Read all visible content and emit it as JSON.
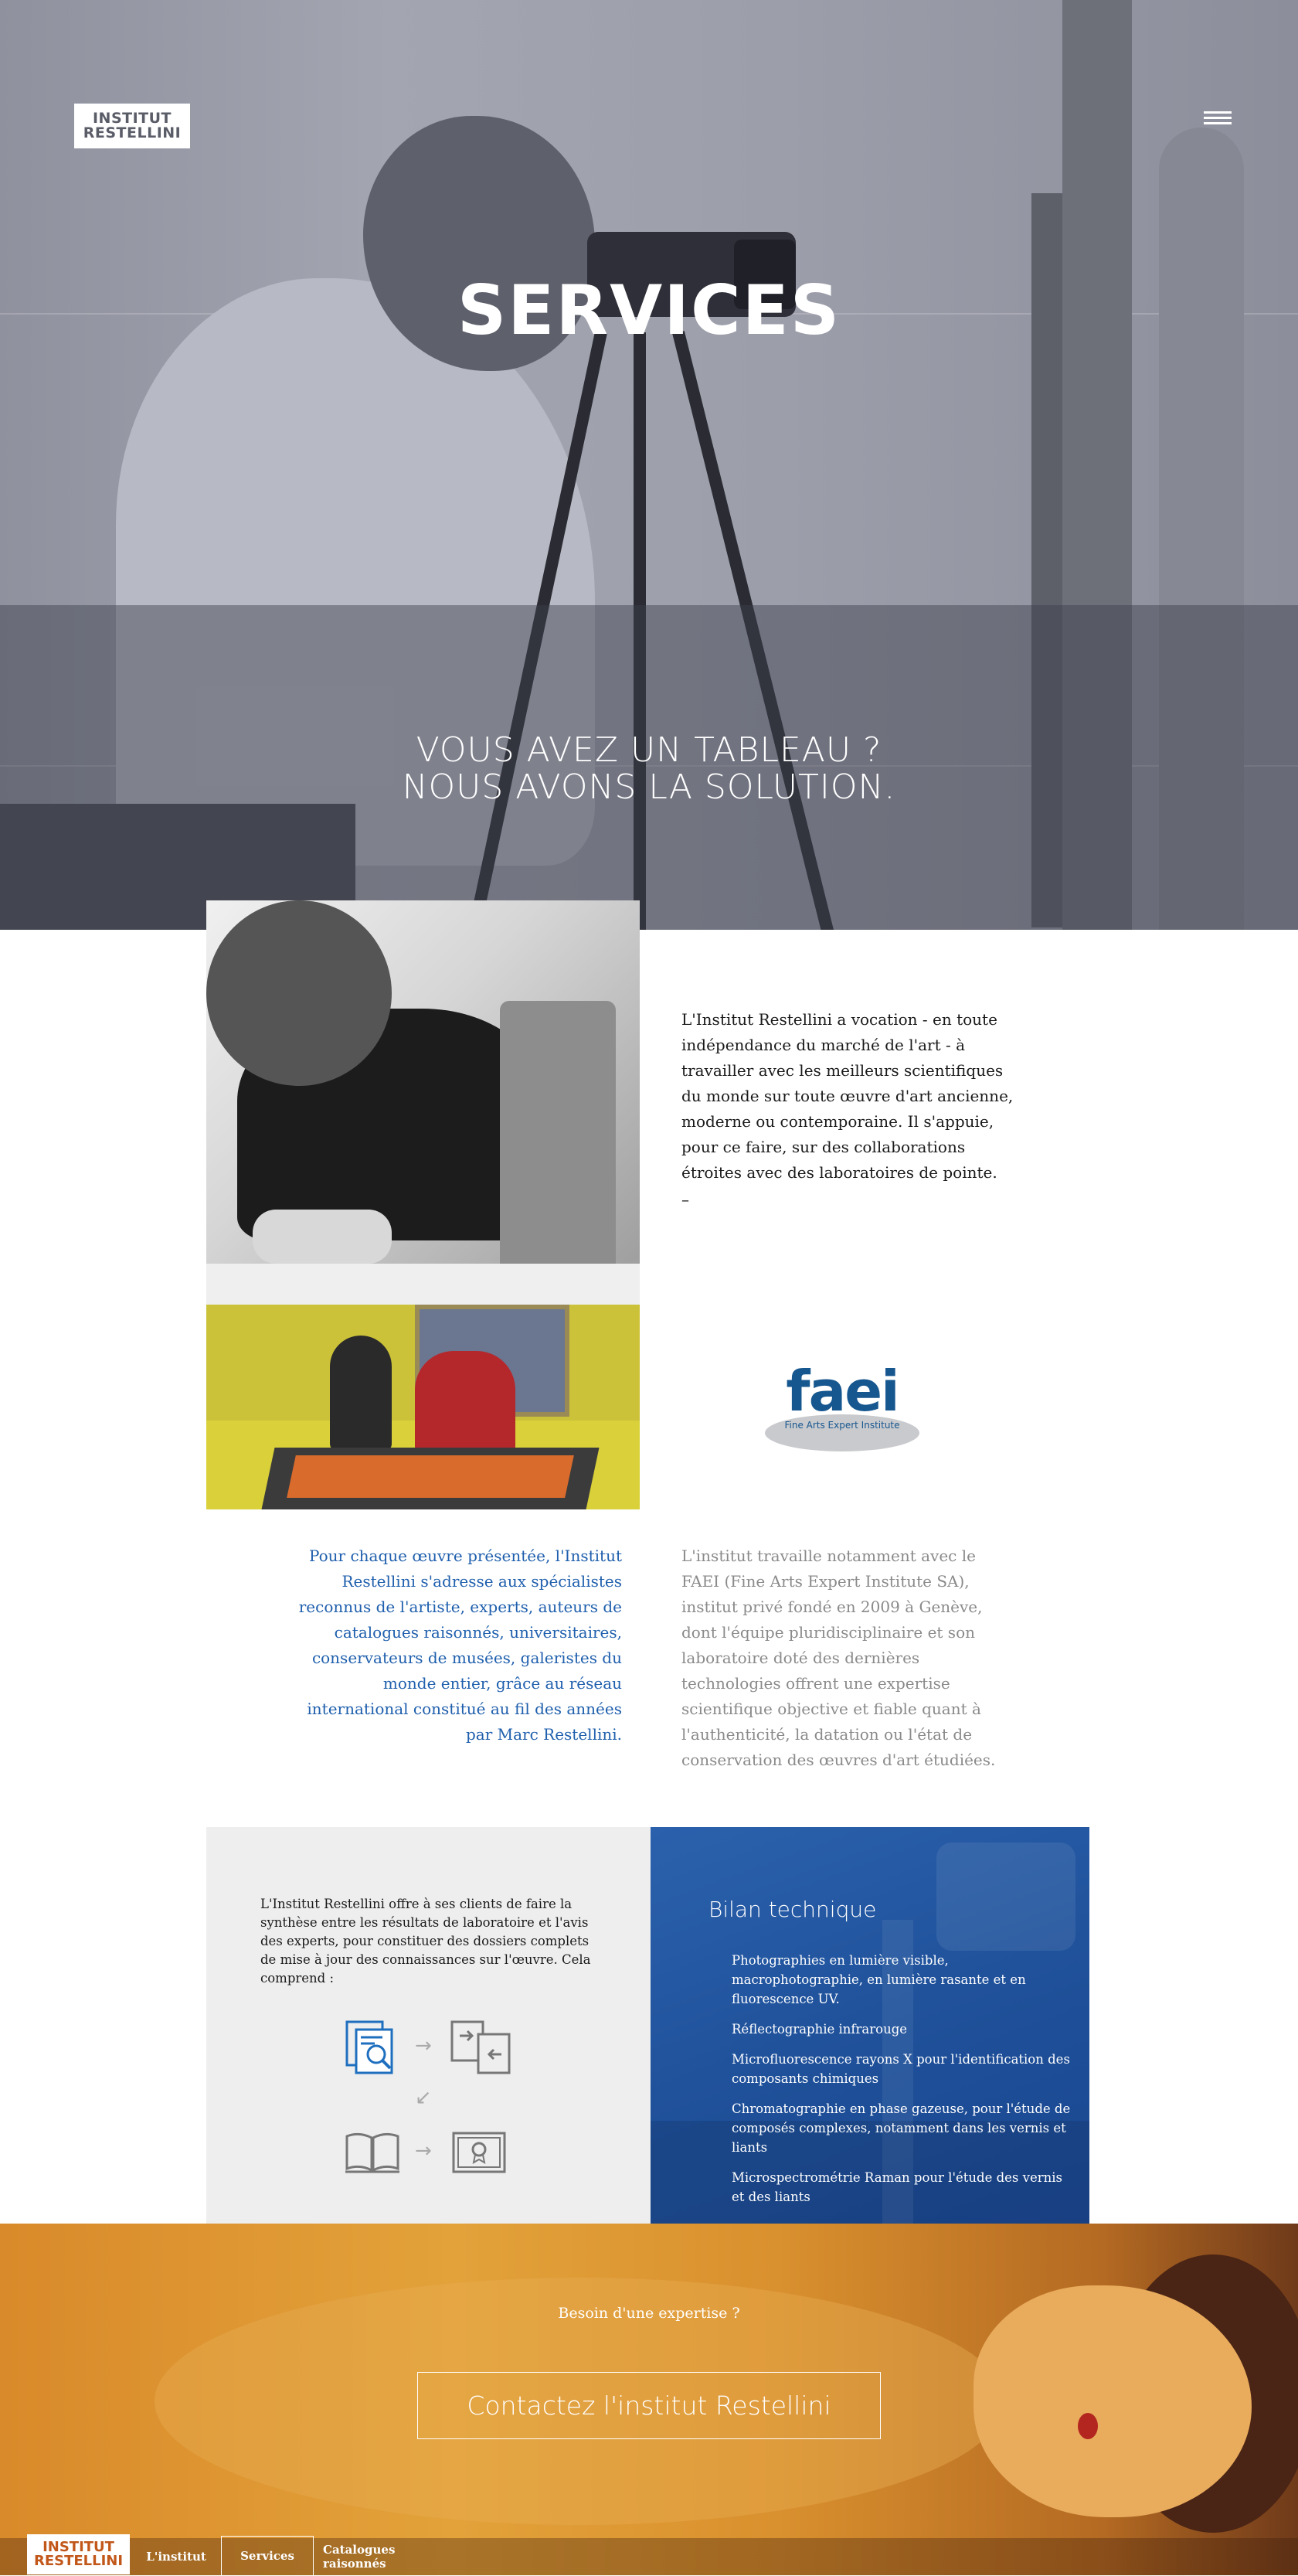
{
  "brand": {
    "logo_line1": "INSTITUT",
    "logo_line2": "RESTELLINI"
  },
  "hero": {
    "title": "SERVICES",
    "subtitle_line1": "VOUS AVEZ UN TABLEAU ?",
    "subtitle_line2": "NOUS AVONS LA SOLUTION."
  },
  "intro": {
    "paragraph": "L'Institut Restellini a vocation - en toute indépendance du marché de l'art - à travailler avec les meilleurs scientifiques du monde sur toute œuvre d'art ancienne, moderne ou contemporaine. Il s'appuie, pour ce faire, sur des collaborations étroites avec des laboratoires de pointe.",
    "dash": "–"
  },
  "faei": {
    "word": "faei",
    "tagline": "Fine Arts Expert Institute"
  },
  "specialists_text": "Pour chaque œuvre présentée, l'Institut Restellini s'adresse aux spécialistes reconnus de l'artiste, experts, auteurs de catalogues raisonnés, universitaires, conservateurs de musées, galeristes du monde entier, grâce au réseau international constitué au fil des années par Marc Restellini.",
  "faei_text": "L'institut travaille notamment avec le FAEI (Fine Arts Expert Institute SA), institut privé fondé en 2009 à Genève, dont l'équipe pluridisciplinaire et son laboratoire doté des dernières technologies offrent une expertise scientifique objective et fiable quant à l'authenticité, la datation ou l'état de conservation des œuvres d'art étudiées.",
  "services_panel": {
    "intro": "L'Institut Restellini offre à ses clients de faire la synthèse entre les résultats de laboratoire et l'avis des experts, pour constituer des dossiers complets de mise à jour des connaissances sur l'œuvre. Cela comprend :",
    "icons": [
      "document-search-icon",
      "document-exchange-icon",
      "open-book-icon",
      "certificate-icon"
    ],
    "arrow": "→",
    "arrow_diag": "↙"
  },
  "bilan": {
    "title": "Bilan technique",
    "items": [
      "Photographies en lumière visible, macrophotographie, en lumière rasante et en fluorescence UV.",
      "Réflectographie infrarouge",
      "Microfluorescence rayons X pour l'identification des composants chimiques",
      "Chromatographie en phase gazeuse, pour l'étude de composés complexes, notamment dans les vernis et liants",
      "Microspectrométrie Raman pour l'étude des vernis et des liants"
    ]
  },
  "cta": {
    "question": "Besoin d'une expertise ?",
    "button": "Contactez l'institut Restellini"
  },
  "footer_nav": [
    {
      "label": "L'institut",
      "active": false
    },
    {
      "label": "Services",
      "active": true
    },
    {
      "label": "Catalogues raisonnés",
      "active": false
    }
  ],
  "colors": {
    "accent_blue": "#1f5fad",
    "panel_blue": "#1e4f98",
    "logo_orange": "#c2571a"
  }
}
